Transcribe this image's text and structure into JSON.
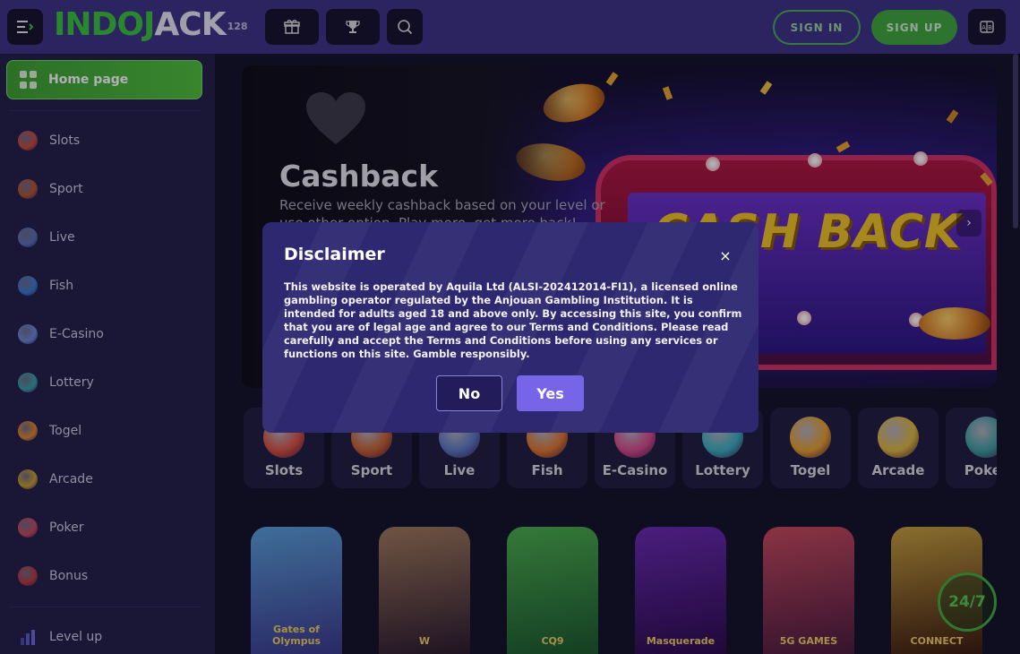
{
  "header": {
    "logo_text_a": "INDO",
    "logo_text_b": "J",
    "logo_text_c": "ACK",
    "logo_sup": "128",
    "sign_in": "SIGN IN",
    "sign_up": "SIGN UP"
  },
  "sidebar": {
    "home": "Home page",
    "items": [
      {
        "label": "Slots",
        "color": "#c84a3a"
      },
      {
        "label": "Sport",
        "color": "#b5542a"
      },
      {
        "label": "Live",
        "color": "#5a72b8"
      },
      {
        "label": "Fish",
        "color": "#3a7ad0"
      },
      {
        "label": "E-Casino",
        "color": "#6a8ad8"
      },
      {
        "label": "Lottery",
        "color": "#3aa0a8"
      },
      {
        "label": "Togel",
        "color": "#e0862a"
      },
      {
        "label": "Arcade",
        "color": "#c8a02a"
      },
      {
        "label": "Poker",
        "color": "#c84a5a"
      },
      {
        "label": "Bonus",
        "color": "#b83a3a"
      }
    ],
    "level_up": "Level up"
  },
  "banner": {
    "title": "Cashback",
    "text": "Receive weekly cashback based on your level or use other option. Play more, get more back!",
    "image_text": "CASH BACK"
  },
  "categories": [
    {
      "label": "Slots",
      "color": "#d9503c"
    },
    {
      "label": "Sport",
      "color": "#c9602a"
    },
    {
      "label": "Live",
      "color": "#5a78c0"
    },
    {
      "label": "Fish",
      "color": "#e0782a"
    },
    {
      "label": "E-Casino",
      "color": "#d84a8a"
    },
    {
      "label": "Lottery",
      "color": "#3ab0c0"
    },
    {
      "label": "Togel",
      "color": "#e8a02a"
    },
    {
      "label": "Arcade",
      "color": "#e0b83a"
    },
    {
      "label": "Poker",
      "color": "#3aa0a0"
    }
  ],
  "games": [
    {
      "name": "Gates of Olympus",
      "color1": "#5aa0d8",
      "color2": "#3a3a8a"
    },
    {
      "name": "W",
      "color1": "#a07a58",
      "color2": "#2a1a2a"
    },
    {
      "name": "CQ9",
      "color1": "#4ab04a",
      "color2": "#1a5a2a"
    },
    {
      "name": "Masquerade",
      "color1": "#6a2ab0",
      "color2": "#2a0a4a"
    },
    {
      "name": "5G GAMES",
      "color1": "#c84a5a",
      "color2": "#4a1a3a"
    },
    {
      "name": "CONNECT",
      "color1": "#c8a03a",
      "color2": "#3a1a0a"
    }
  ],
  "chat_badge": "24/7",
  "modal": {
    "title": "Disclaimer",
    "close": "×",
    "body": "This website is operated by Aquila Ltd (ALSI-202412014-FI1), a licensed online gambling operator regulated by the Anjouan Gambling Institution. It is intended for adults aged 18 and above only. By accessing this site, you confirm that you are of legal age and agree to our Terms and Conditions. Please read carefully and accept the Terms and Conditions before using any services or functions on this site. Gamble responsibly.",
    "no": "No",
    "yes": "Yes"
  },
  "colors": {
    "header": "#3d3385",
    "sidebar": "#221f46",
    "accent_green": "#3ea83b",
    "modal_bg": "#2e2870",
    "yes_button": "#7765e8"
  }
}
